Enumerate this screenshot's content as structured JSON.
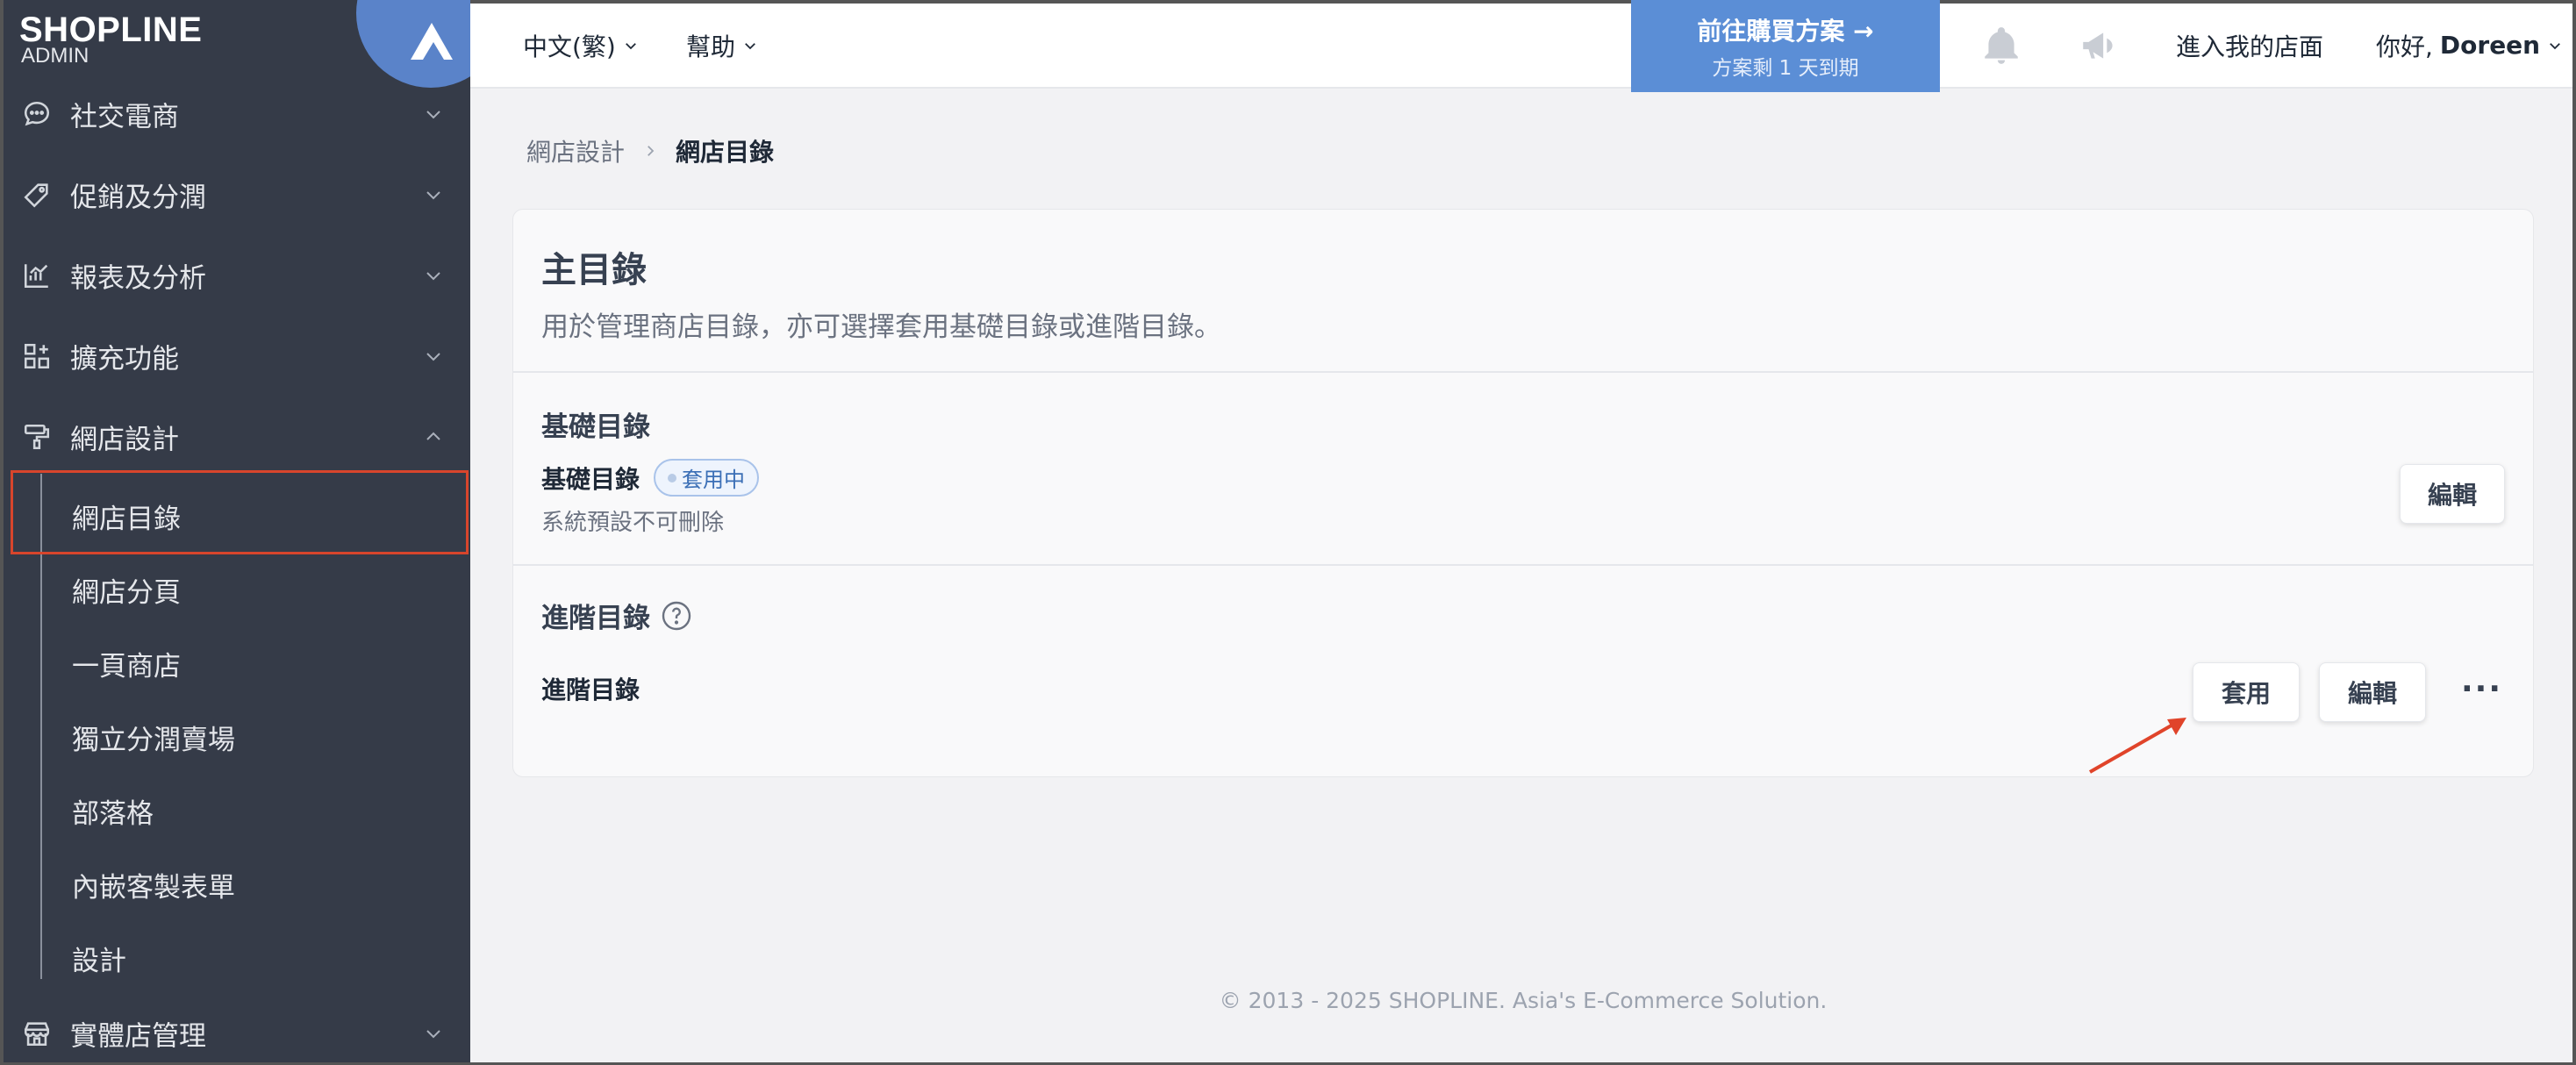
{
  "brand": {
    "logo": "SHOPLINE",
    "logo_sub": "ADMIN"
  },
  "sidebar": {
    "items": [
      {
        "label": "社交電商",
        "icon": "chat-bubble-icon"
      },
      {
        "label": "促銷及分潤",
        "icon": "tag-icon"
      },
      {
        "label": "報表及分析",
        "icon": "chart-icon"
      },
      {
        "label": "擴充功能",
        "icon": "apps-grid-icon"
      },
      {
        "label": "網店設計",
        "icon": "paint-roller-icon"
      },
      {
        "label": "實體店管理",
        "icon": "store-icon"
      }
    ],
    "subitems": [
      "網店目錄",
      "網店分頁",
      "一頁商店",
      "獨立分潤賣場",
      "部落格",
      "內嵌客製表單",
      "設計"
    ]
  },
  "topbar": {
    "language": "中文(繁)",
    "help": "幫助",
    "promo_title": "前往購買方案 →",
    "promo_sub": "方案剩 1 天到期",
    "enter_store": "進入我的店面",
    "greeting": "你好,",
    "user": "Doreen"
  },
  "breadcrumb": {
    "parent": "網店設計",
    "current": "網店目錄"
  },
  "card": {
    "title": "主目錄",
    "desc": "用於管理商店目錄，亦可選擇套用基礎目錄或進階目錄。",
    "basic": {
      "section_title": "基礎目錄",
      "row_label": "基礎目錄",
      "badge": "套用中",
      "note": "系統預設不可刪除",
      "edit_label": "編輯"
    },
    "advanced": {
      "section_title": "進階目錄",
      "row_label": "進階目錄",
      "apply_label": "套用",
      "edit_label": "編輯",
      "more_label": "···"
    }
  },
  "footer": "© 2013 - 2025 SHOPLINE. Asia's E-Commerce Solution."
}
